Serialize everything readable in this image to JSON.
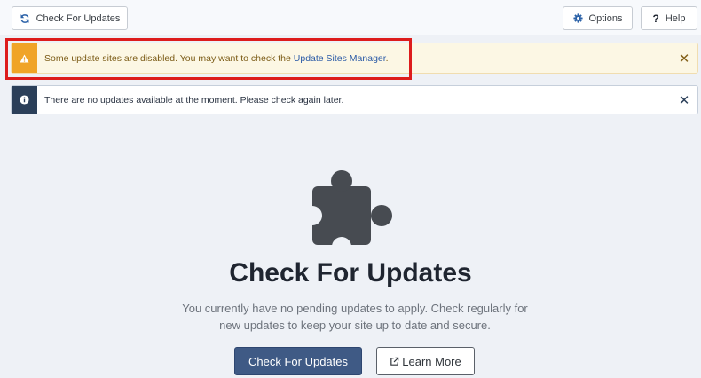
{
  "toolbar": {
    "check_label": "Check For Updates",
    "options_label": "Options",
    "help_label": "Help"
  },
  "alerts": {
    "warning": {
      "text": "Some update sites are disabled. You may want to check the ",
      "link": "Update Sites Manager",
      "suffix": "."
    },
    "info": {
      "text": "There are no updates available at the moment. Please check again later."
    }
  },
  "main": {
    "title": "Check For Updates",
    "description": "You currently have no pending updates to apply. Check regularly for new updates to keep your site up to date and secure.",
    "check_button": "Check For Updates",
    "learn_button": "Learn More"
  },
  "icons": {
    "check": "sync-icon",
    "options": "gear-icon",
    "help": "question-icon",
    "warning": "warning-icon",
    "info": "info-icon",
    "close": "close-icon",
    "hero": "puzzle-icon",
    "external": "external-link-icon"
  },
  "colors": {
    "primary": "#3f5a85",
    "warning": "#f0a427",
    "info": "#2b3f59",
    "highlight": "#dd1c1c"
  }
}
